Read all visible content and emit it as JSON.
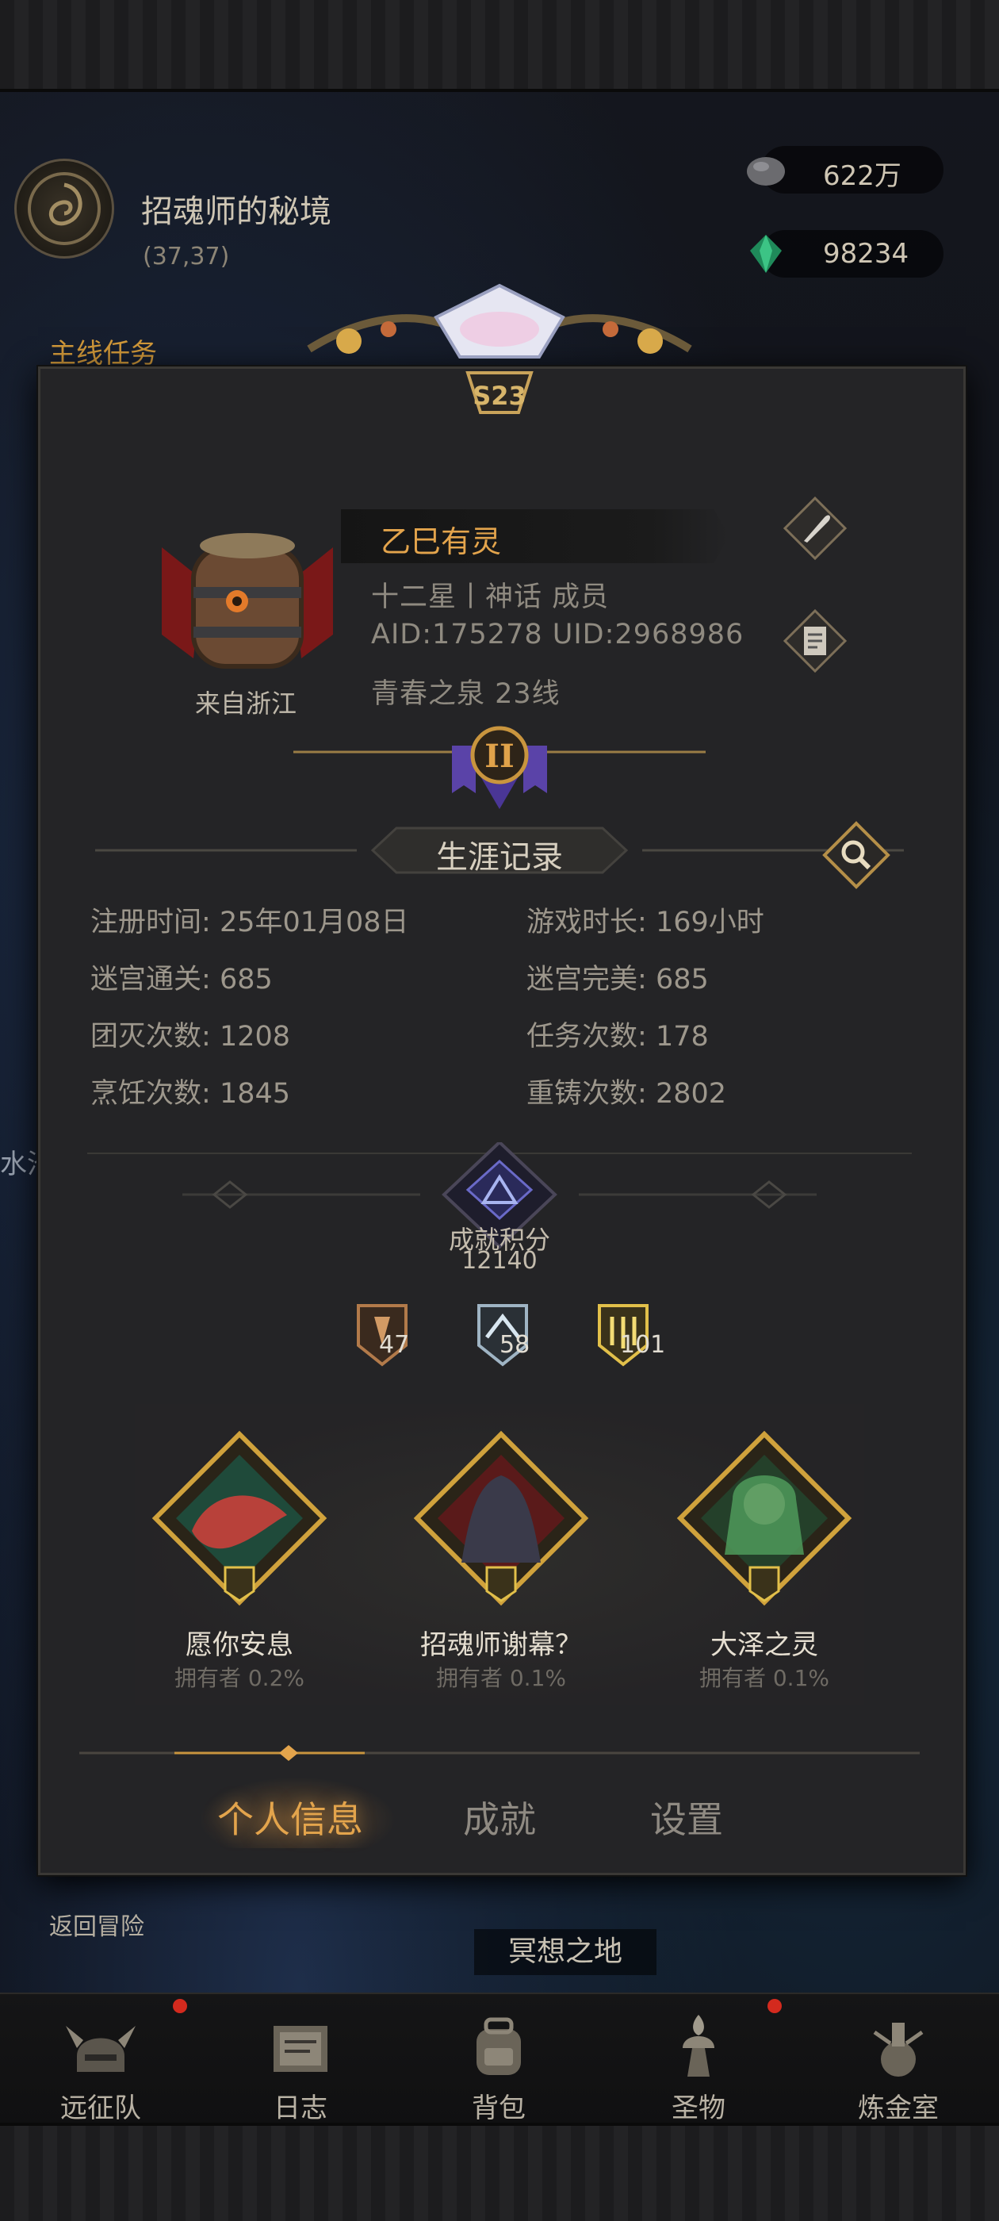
{
  "location": {
    "name": "招魂师的秘境",
    "coords": "(37,37)",
    "task_label": "主线任务"
  },
  "resources": [
    {
      "icon": "stone-icon",
      "value": "622万"
    },
    {
      "icon": "green-gem-icon",
      "value": "98234"
    }
  ],
  "season_badge": "S23",
  "profile": {
    "name": "乙巳有灵",
    "rank": "十二星丨神话  成员",
    "ids": "AID:175278 UID:2968986",
    "server": "青春之泉  23线",
    "origin": "来自浙江",
    "rank_badge": "II"
  },
  "career": {
    "title": "生涯记录",
    "stats": [
      {
        "label": "注册时间:",
        "value": "25年01月08日"
      },
      {
        "label": "游戏时长:",
        "value": "169小时"
      },
      {
        "label": "迷宫通关:",
        "value": "685"
      },
      {
        "label": "迷宫完美:",
        "value": "685"
      },
      {
        "label": "团灭次数:",
        "value": "1208"
      },
      {
        "label": "任务次数:",
        "value": "178"
      },
      {
        "label": "烹饪次数:",
        "value": "1845"
      },
      {
        "label": "重铸次数:",
        "value": "2802"
      }
    ]
  },
  "achievement_score": {
    "label": "成就积分",
    "value": "12140"
  },
  "medals": [
    {
      "tier": "bronze",
      "count": "47"
    },
    {
      "tier": "silver",
      "count": "58"
    },
    {
      "tier": "gold",
      "count": "101"
    }
  ],
  "achievements": [
    {
      "name": "愿你安息",
      "owner": "拥有者  0.2%"
    },
    {
      "name": "招魂师谢幕？",
      "owner": "拥有者  0.1%"
    },
    {
      "name": "大泽之灵",
      "owner": "拥有者  0.1%"
    }
  ],
  "tabs": [
    {
      "label": "个人信息",
      "active": true
    },
    {
      "label": "成就",
      "active": false
    },
    {
      "label": "设置",
      "active": false
    }
  ],
  "back_label": "返回冒险",
  "area_name": "冥想之地",
  "side_label": "水池",
  "nav": [
    {
      "label": "远征队",
      "icon": "viking-helmet-icon"
    },
    {
      "label": "日志",
      "icon": "journal-icon"
    },
    {
      "label": "背包",
      "icon": "backpack-icon"
    },
    {
      "label": "圣物",
      "icon": "relic-icon"
    },
    {
      "label": "炼金室",
      "icon": "alchemy-icon"
    }
  ],
  "colors": {
    "accent": "#e3a44c",
    "panel": "#242426",
    "text": "#9d978c"
  }
}
